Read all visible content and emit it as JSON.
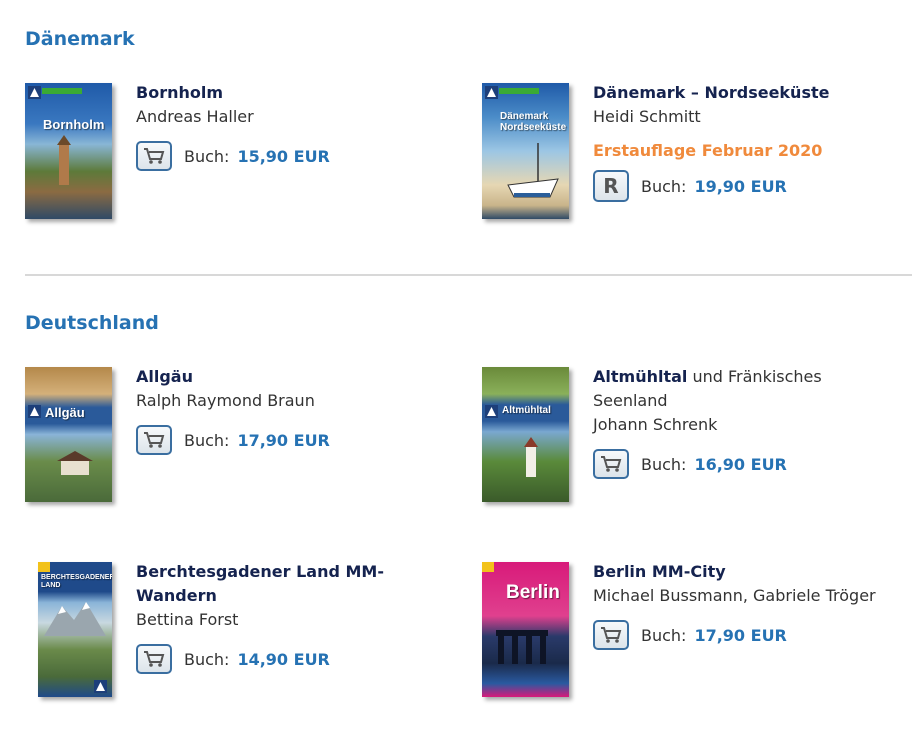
{
  "sections": [
    {
      "title": "Dänemark",
      "books": [
        {
          "title": "Bornholm",
          "title_rest": "",
          "author": "Andreas Haller",
          "notice": "",
          "buy_label": "Buch:",
          "price": "15,90 EUR",
          "cover_text": "Bornholm",
          "button": "cart-icon"
        },
        {
          "title": "Dänemark – Nordseeküste",
          "title_rest": "",
          "author": "Heidi Schmitt",
          "notice": "Erstauflage Februar 2020",
          "buy_label": "Buch:",
          "price": "19,90 EUR",
          "cover_text": "Dänemark Nordseeküste",
          "button": "reserve-r-icon"
        }
      ]
    },
    {
      "title": "Deutschland",
      "books": [
        {
          "title": "Allgäu",
          "title_rest": "",
          "author": "Ralph Raymond Braun",
          "notice": "",
          "buy_label": "Buch:",
          "price": "17,90 EUR",
          "cover_text": "Allgäu",
          "button": "cart-icon"
        },
        {
          "title": "Altmühltal",
          "title_rest": "und Fränkisches Seenland",
          "author": "Johann Schrenk",
          "notice": "",
          "buy_label": "Buch:",
          "price": "16,90 EUR",
          "cover_text": "Altmühltal",
          "button": "cart-icon"
        },
        {
          "title": "Berchtesgadener Land MM-Wandern",
          "title_rest": "",
          "author": "Bettina Forst",
          "notice": "",
          "buy_label": "Buch:",
          "price": "14,90 EUR",
          "cover_text": "BERCHTESGADENER LAND",
          "button": "cart-icon"
        },
        {
          "title": "Berlin MM-City",
          "title_rest": "",
          "author": "Michael Bussmann, Gabriele Tröger",
          "notice": "",
          "buy_label": "Buch:",
          "price": "17,90 EUR",
          "cover_text": "Berlin",
          "button": "cart-icon"
        }
      ]
    }
  ],
  "colors": {
    "accent": "#2672b3",
    "title": "#15234f",
    "notice": "#f08a3c",
    "divider": "#d8d8d8"
  }
}
